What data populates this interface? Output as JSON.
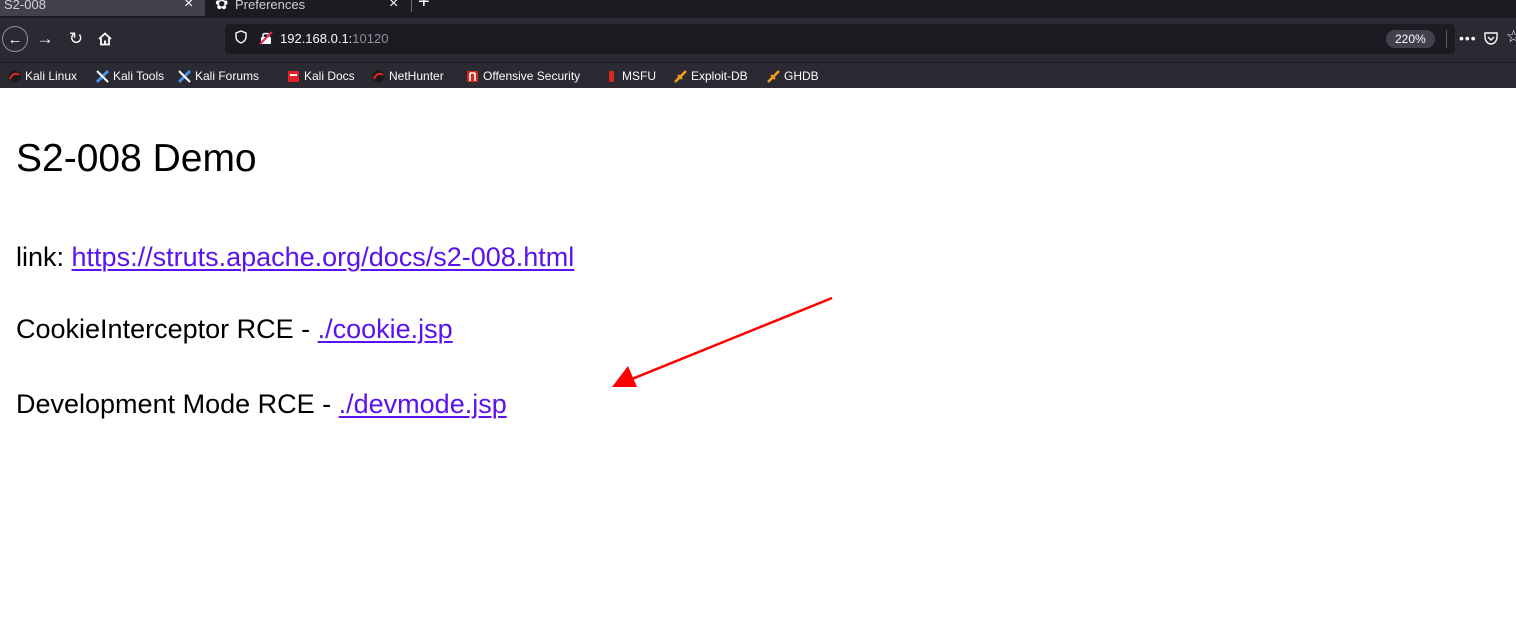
{
  "browser": {
    "tabs": [
      {
        "title": "S2-008",
        "active": true
      },
      {
        "title": "Preferences",
        "active": false
      }
    ],
    "url": {
      "host": "192.168.0.1:",
      "port": "10120"
    },
    "zoom": "220%",
    "page_actions": "•••"
  },
  "bookmarks": [
    {
      "label": "Kali Linux",
      "icon": "kali-dragon-icon"
    },
    {
      "label": "Kali Tools",
      "icon": "kali-tools-icon"
    },
    {
      "label": "Kali Forums",
      "icon": "kali-tools-icon"
    },
    {
      "label": "Kali Docs",
      "icon": "kali-docs-icon"
    },
    {
      "label": "NetHunter",
      "icon": "kali-dragon-icon"
    },
    {
      "label": "Offensive Security",
      "icon": "offsec-icon"
    },
    {
      "label": "MSFU",
      "icon": "msfu-icon"
    },
    {
      "label": "Exploit-DB",
      "icon": "exploitdb-icon"
    },
    {
      "label": "GHDB",
      "icon": "exploitdb-icon"
    }
  ],
  "page": {
    "title": "S2-008 Demo",
    "lines": [
      {
        "prefix": "link: ",
        "link": "https://struts.apache.org/docs/s2-008.html"
      },
      {
        "prefix": "CookieInterceptor RCE - ",
        "link": "./cookie.jsp"
      },
      {
        "prefix": "Development Mode RCE - ",
        "link": "./devmode.jsp"
      }
    ]
  },
  "colors": {
    "link": "#5a12ee",
    "annotation_arrow": "#ff0000",
    "toolbar": "#2b2a33"
  }
}
